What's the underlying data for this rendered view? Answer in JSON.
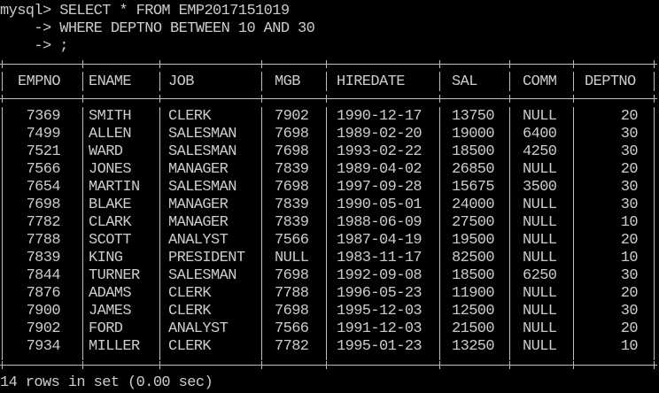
{
  "console": {
    "prompt_line_1": "mysql> SELECT * FROM EMP2017151019",
    "prompt_line_2": "    -> WHERE DEPTNO BETWEEN 10 AND 30",
    "prompt_line_3": "    -> ;",
    "footer": "14 rows in set (0.00 sec)"
  },
  "table": {
    "columns": [
      "EMPNO",
      "ENAME",
      "JOB",
      "MGB",
      "HIREDATE",
      "SAL",
      "COMM",
      "DEPTNO"
    ],
    "rows": [
      [
        "7369",
        "SMITH",
        "CLERK",
        "7902",
        "1990-12-17",
        "13750",
        "NULL",
        "20"
      ],
      [
        "7499",
        "ALLEN",
        "SALESMAN",
        "7698",
        "1989-02-20",
        "19000",
        "6400",
        "30"
      ],
      [
        "7521",
        "WARD",
        "SALESMAN",
        "7698",
        "1993-02-22",
        "18500",
        "4250",
        "30"
      ],
      [
        "7566",
        "JONES",
        "MANAGER",
        "7839",
        "1989-04-02",
        "26850",
        "NULL",
        "20"
      ],
      [
        "7654",
        "MARTIN",
        "SALESMAN",
        "7698",
        "1997-09-28",
        "15675",
        "3500",
        "30"
      ],
      [
        "7698",
        "BLAKE",
        "MANAGER",
        "7839",
        "1990-05-01",
        "24000",
        "NULL",
        "30"
      ],
      [
        "7782",
        "CLARK",
        "MANAGER",
        "7839",
        "1988-06-09",
        "27500",
        "NULL",
        "10"
      ],
      [
        "7788",
        "SCOTT",
        "ANALYST",
        "7566",
        "1987-04-19",
        "19500",
        "NULL",
        "20"
      ],
      [
        "7839",
        "KING",
        "PRESIDENT",
        "NULL",
        "1983-11-17",
        "82500",
        "NULL",
        "10"
      ],
      [
        "7844",
        "TURNER",
        "SALESMAN",
        "7698",
        "1992-09-08",
        "18500",
        "6250",
        "30"
      ],
      [
        "7876",
        "ADAMS",
        "CLERK",
        "7788",
        "1996-05-23",
        "11900",
        "NULL",
        "20"
      ],
      [
        "7900",
        "JAMES",
        "CLERK",
        "7698",
        "1995-12-03",
        "12500",
        "NULL",
        "30"
      ],
      [
        "7902",
        "FORD",
        "ANALYST",
        "7566",
        "1991-12-03",
        "21500",
        "NULL",
        "20"
      ],
      [
        "7934",
        "MILLER",
        "CLERK",
        "7782",
        "1995-01-23",
        "13250",
        "NULL",
        "10"
      ]
    ]
  }
}
